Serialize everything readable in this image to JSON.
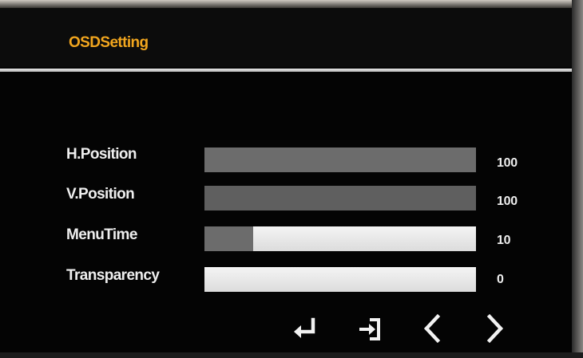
{
  "osd": {
    "title": "OSDSetting"
  },
  "colors": {
    "title": "#f2a61e",
    "text": "#eeeeee",
    "track": "#6c6c6c",
    "fill": "#efefef",
    "background": "#050505"
  },
  "settings": [
    {
      "label": "H.Position",
      "value": "100",
      "level": 0
    },
    {
      "label": "V.Position",
      "value": "100",
      "level": 0
    },
    {
      "label": "MenuTime",
      "value": "10",
      "level": 0.82
    },
    {
      "label": "Transparency",
      "value": "0",
      "level": 1
    }
  ],
  "navigation": [
    {
      "icon": "enter-icon"
    },
    {
      "icon": "exit-icon"
    },
    {
      "icon": "chevron-left-icon"
    },
    {
      "icon": "chevron-right-icon"
    }
  ]
}
